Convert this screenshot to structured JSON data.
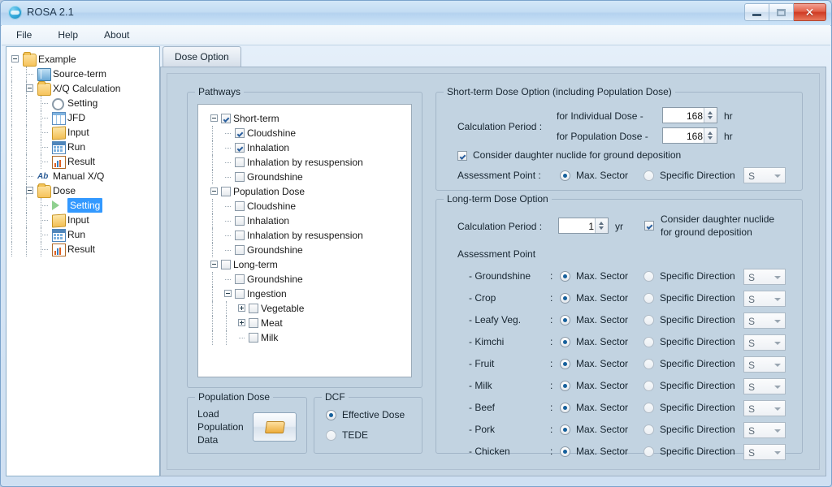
{
  "window": {
    "title": "ROSA 2.1",
    "logo_icon": "rosa-logo-icon",
    "min_label": "",
    "max_label": "",
    "close_label": "✕"
  },
  "menu": {
    "items": [
      "File",
      "Help",
      "About"
    ]
  },
  "tree": {
    "nodes": [
      {
        "label": "Example",
        "depth": 0,
        "icon": "folder-icon",
        "expander": "minus",
        "selected": false
      },
      {
        "label": "Source-term",
        "depth": 1,
        "icon": "book-icon",
        "expander": "none",
        "selected": false
      },
      {
        "label": "X/Q Calculation",
        "depth": 1,
        "icon": "folder-icon",
        "expander": "minus",
        "selected": false
      },
      {
        "label": "Setting",
        "depth": 2,
        "icon": "gear-icon",
        "expander": "none",
        "selected": false
      },
      {
        "label": "JFD",
        "depth": 2,
        "icon": "grid-icon",
        "expander": "none",
        "selected": false
      },
      {
        "label": "Input",
        "depth": 2,
        "icon": "input-icon",
        "expander": "none",
        "selected": false
      },
      {
        "label": "Run",
        "depth": 2,
        "icon": "run-icon",
        "expander": "none",
        "selected": false
      },
      {
        "label": "Result",
        "depth": 2,
        "icon": "chart-icon",
        "expander": "none",
        "selected": false
      },
      {
        "label": "Manual X/Q",
        "depth": 1,
        "icon": "ab-icon",
        "expander": "none",
        "selected": false
      },
      {
        "label": "Dose",
        "depth": 1,
        "icon": "folder-icon",
        "expander": "minus",
        "selected": false
      },
      {
        "label": "Setting",
        "depth": 2,
        "icon": "play-icon",
        "expander": "none",
        "selected": true
      },
      {
        "label": "Input",
        "depth": 2,
        "icon": "input-icon",
        "expander": "none",
        "selected": false
      },
      {
        "label": "Run",
        "depth": 2,
        "icon": "run-icon",
        "expander": "none",
        "selected": false
      },
      {
        "label": "Result",
        "depth": 2,
        "icon": "chart-icon",
        "expander": "none",
        "selected": false
      }
    ]
  },
  "tabs": [
    {
      "label": "Dose Option",
      "active": true
    }
  ],
  "pathways": {
    "caption": "Pathways",
    "nodes": [
      {
        "label": "Short-term",
        "depth": 0,
        "checked": true,
        "expander": "minus"
      },
      {
        "label": "Cloudshine",
        "depth": 1,
        "checked": true,
        "expander": "none"
      },
      {
        "label": "Inhalation",
        "depth": 1,
        "checked": true,
        "expander": "none"
      },
      {
        "label": "Inhalation by resuspension",
        "depth": 1,
        "checked": false,
        "expander": "none"
      },
      {
        "label": "Groundshine",
        "depth": 1,
        "checked": false,
        "expander": "none"
      },
      {
        "label": "Population Dose",
        "depth": 0,
        "checked": false,
        "expander": "minus"
      },
      {
        "label": "Cloudshine",
        "depth": 1,
        "checked": false,
        "expander": "none"
      },
      {
        "label": "Inhalation",
        "depth": 1,
        "checked": false,
        "expander": "none"
      },
      {
        "label": "Inhalation by resuspension",
        "depth": 1,
        "checked": false,
        "expander": "none"
      },
      {
        "label": "Groundshine",
        "depth": 1,
        "checked": false,
        "expander": "none"
      },
      {
        "label": "Long-term",
        "depth": 0,
        "checked": false,
        "expander": "minus"
      },
      {
        "label": "Groundshine",
        "depth": 1,
        "checked": false,
        "expander": "none"
      },
      {
        "label": "Ingestion",
        "depth": 1,
        "checked": false,
        "expander": "minus"
      },
      {
        "label": "Vegetable",
        "depth": 2,
        "checked": false,
        "expander": "plus"
      },
      {
        "label": "Meat",
        "depth": 2,
        "checked": false,
        "expander": "plus"
      },
      {
        "label": "Milk",
        "depth": 2,
        "checked": false,
        "expander": "none"
      }
    ]
  },
  "population_dose": {
    "caption": "Population Dose",
    "load_label": "Load\nPopulation\nData",
    "open_button_icon": "open-folder-icon"
  },
  "dcf": {
    "caption": "DCF",
    "options": [
      {
        "label": "Effective Dose",
        "selected": true
      },
      {
        "label": "TEDE",
        "selected": false
      }
    ]
  },
  "short_term": {
    "caption": "Short-term Dose Option (including Population Dose)",
    "calc_period_label": "Calculation Period :",
    "rows": [
      {
        "label": "for Individual Dose  -",
        "value": "168",
        "unit": "hr"
      },
      {
        "label": "for Population Dose -",
        "value": "168",
        "unit": "hr"
      }
    ],
    "daughter_checkbox": {
      "label": "Consider daughter nuclide for ground deposition",
      "checked": true
    },
    "assessment_label": "Assessment Point :",
    "max_sector_label": "Max. Sector",
    "specific_direction_label": "Specific Direction",
    "max_sector_selected": true,
    "direction_value": "S"
  },
  "long_term": {
    "caption": "Long-term Dose Option",
    "calc_period_label": "Calculation Period :",
    "calc_period_value": "1",
    "calc_period_unit": "yr",
    "daughter_checkbox": {
      "label_line1": "Consider daughter nuclide",
      "label_line2": "for ground deposition",
      "checked": true
    },
    "assessment_label": "Assessment Point",
    "max_sector_label": "Max. Sector",
    "specific_direction_label": "Specific Direction",
    "rows": [
      {
        "label": "- Groundshine",
        "max_sector": true,
        "direction": "S"
      },
      {
        "label": "- Crop",
        "max_sector": true,
        "direction": "S"
      },
      {
        "label": "- Leafy Veg.",
        "max_sector": true,
        "direction": "S"
      },
      {
        "label": "- Kimchi",
        "max_sector": true,
        "direction": "S"
      },
      {
        "label": "- Fruit",
        "max_sector": true,
        "direction": "S"
      },
      {
        "label": "- Milk",
        "max_sector": true,
        "direction": "S"
      },
      {
        "label": "- Beef",
        "max_sector": true,
        "direction": "S"
      },
      {
        "label": "- Pork",
        "max_sector": true,
        "direction": "S"
      },
      {
        "label": "- Chicken",
        "max_sector": true,
        "direction": "S"
      }
    ],
    "colon": ":"
  },
  "colors": {
    "accent": "#3399ff",
    "panel": "#c2d3e1",
    "titlebar": "#c3dcf3",
    "close": "#cf3a23"
  }
}
